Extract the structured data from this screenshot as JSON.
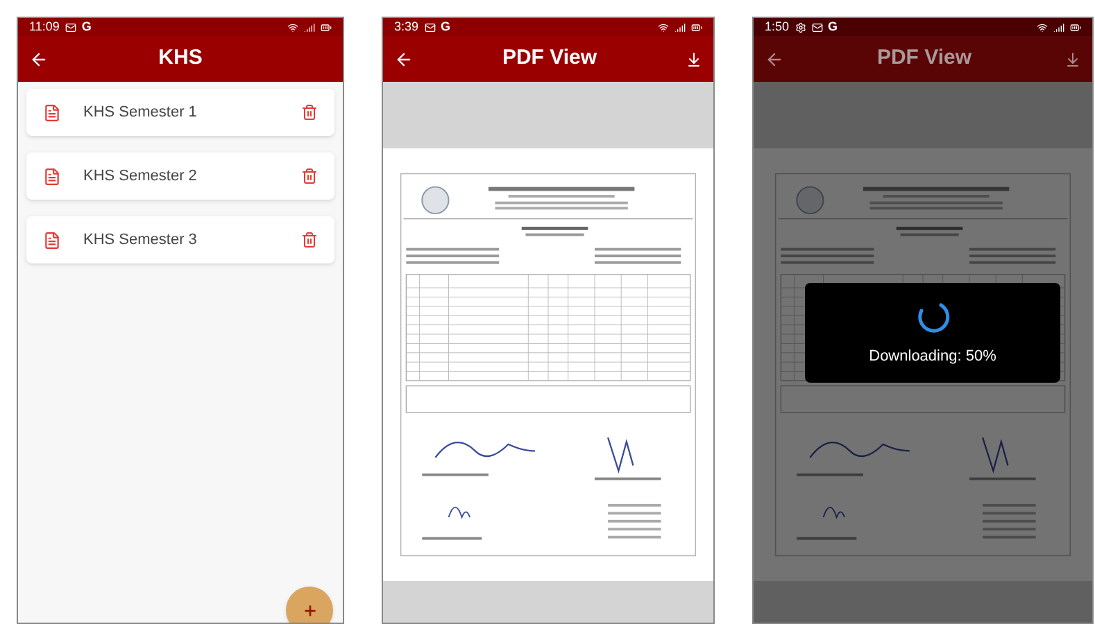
{
  "screens": [
    {
      "kind": "list",
      "status_bar": {
        "time": "11:09",
        "carrier": "G",
        "settings_indicator": false
      },
      "app_bar": {
        "title": "KHS",
        "download_action": false
      },
      "items": [
        {
          "label": "KHS Semester 1"
        },
        {
          "label": "KHS Semester 2"
        },
        {
          "label": "KHS Semester 3"
        }
      ]
    },
    {
      "kind": "pdf",
      "status_bar": {
        "time": "3:39",
        "carrier": "G",
        "settings_indicator": false
      },
      "app_bar": {
        "title": "PDF View",
        "download_action": true
      },
      "dimmed": false
    },
    {
      "kind": "pdf",
      "status_bar": {
        "time": "1:50",
        "carrier": "G",
        "settings_indicator": true
      },
      "app_bar": {
        "title": "PDF View",
        "download_action": true
      },
      "dimmed": true,
      "dialog": {
        "message": "Downloading: 50%"
      }
    }
  ]
}
